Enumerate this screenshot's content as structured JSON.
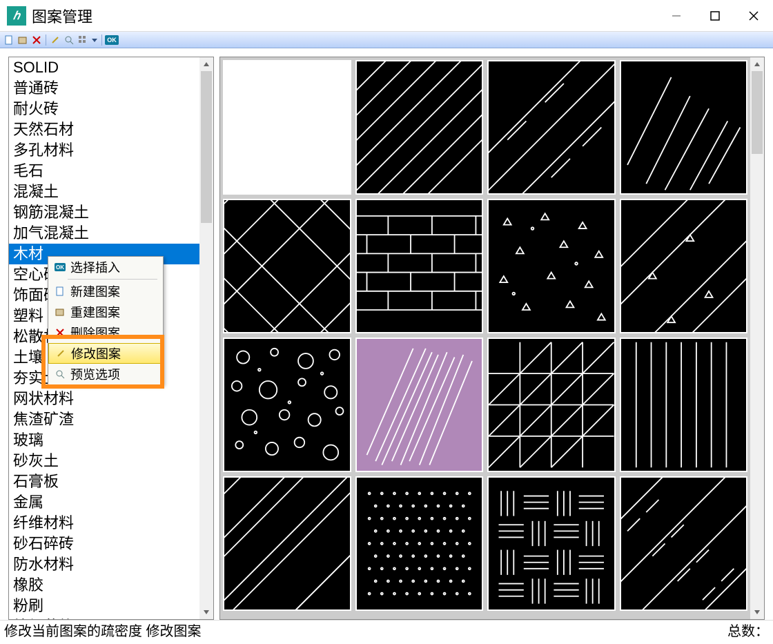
{
  "window": {
    "title": "图案管理"
  },
  "list": {
    "items": [
      "SOLID",
      "普通砖",
      "耐火砖",
      "天然石材",
      "多孔材料",
      "毛石",
      "混凝土",
      "钢筋混凝土",
      "加气混凝土",
      "木材",
      "空心砖",
      "饰面砖",
      "塑料",
      "松散材料",
      "土壤",
      "夯实土壤",
      "网状材料",
      "焦渣矿渣",
      "玻璃",
      "砂灰土",
      "石膏板",
      "金属",
      "纤维材料",
      "砂石碎砖",
      "防水材料",
      "橡胶",
      "粉刷",
      "编织花纹"
    ],
    "selected_index": 9
  },
  "context_menu": {
    "items": [
      {
        "label": "选择插入",
        "icon": "ok"
      },
      {
        "label": "新建图案",
        "icon": "new"
      },
      {
        "label": "重建图案",
        "icon": "rebuild"
      },
      {
        "label": "删除图案",
        "icon": "delete"
      },
      {
        "label": "修改图案",
        "icon": "edit"
      },
      {
        "label": "预览选项",
        "icon": "preview"
      }
    ],
    "hovered_index": 4
  },
  "statusbar": {
    "left": "修改当前图案的疏密度  修改图案",
    "right": "总数："
  },
  "toolbar": {
    "ok_label": "OK"
  }
}
